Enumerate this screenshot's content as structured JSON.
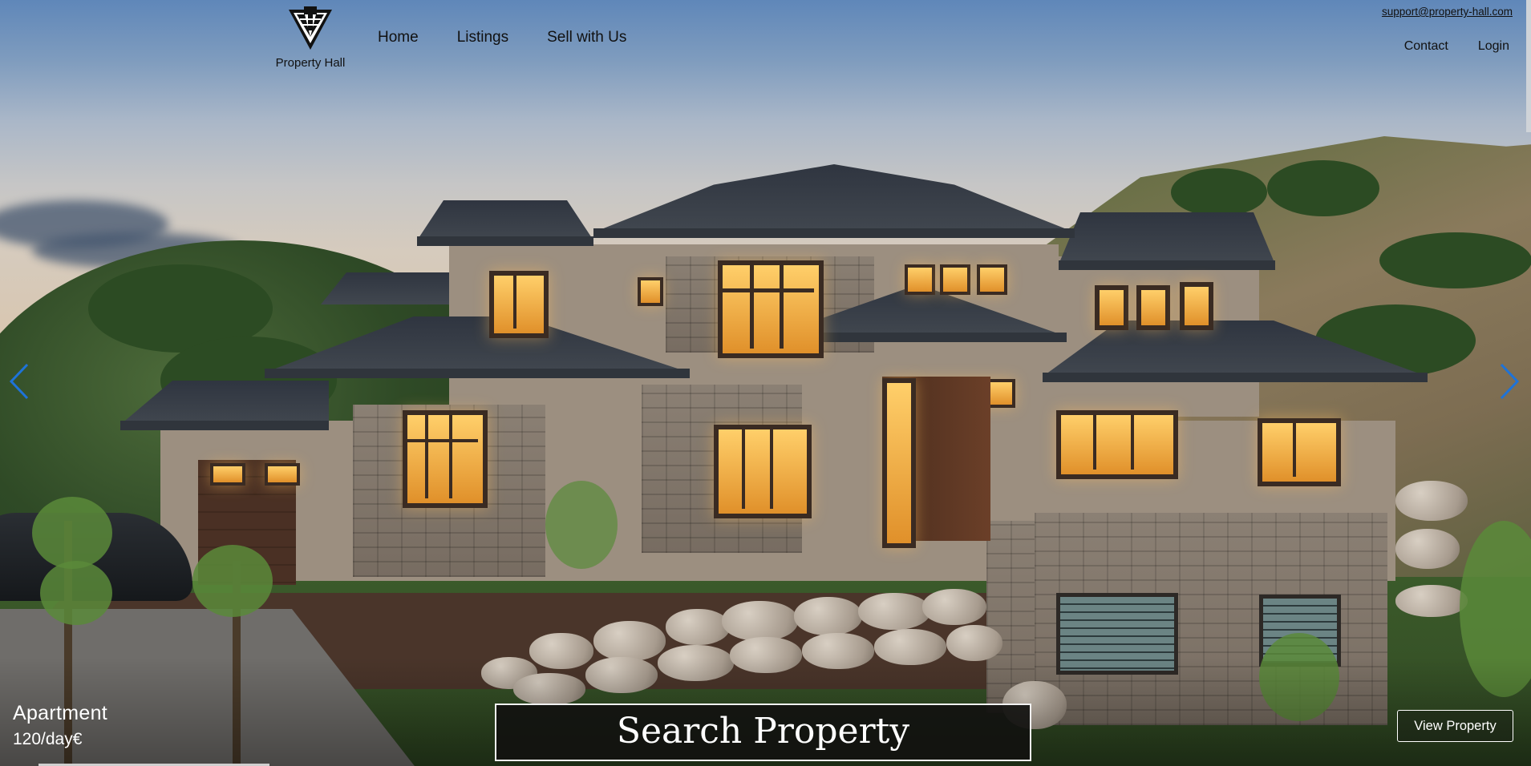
{
  "brand": {
    "name": "Property Hall"
  },
  "nav": {
    "items": [
      "Home",
      "Listings",
      "Sell with Us"
    ]
  },
  "top_right": {
    "email": "support@property-hall.com",
    "links": [
      "Contact",
      "Login"
    ]
  },
  "slide": {
    "property_type": "Apartment",
    "price": "120/day€",
    "search_label": "Search Property",
    "view_label": "View Property",
    "progress": 0.15
  },
  "icons": {
    "logo": "building-logo-icon",
    "prev": "chevron-left-icon",
    "next": "chevron-right-icon"
  },
  "colors": {
    "arrow": "#1e73d8",
    "search_bg": "#121210",
    "text_dark": "#111111",
    "text_light": "#ffffff"
  }
}
